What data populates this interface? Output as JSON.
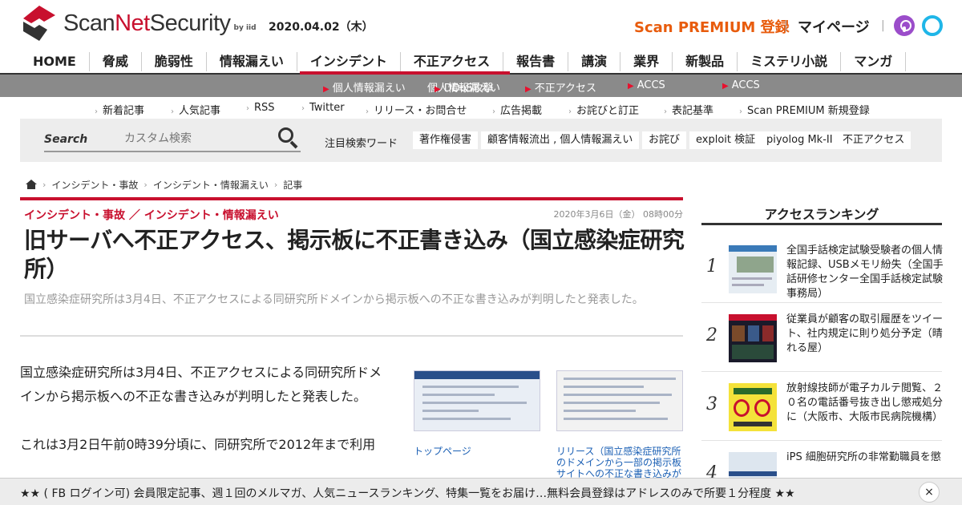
{
  "header": {
    "logo_text_scan": "Scan",
    "logo_text_net": "Net",
    "logo_text_security": "Security",
    "logo_byiid": "by iid",
    "date": "2020.04.02（木）",
    "premium_label": "Scan PREMIUM 登録",
    "mypage_label": "マイページ",
    "separator": "|"
  },
  "nav": {
    "items": [
      "HOME",
      "脅威",
      "脆弱性",
      "情報漏えい",
      "インシデント",
      "不正アクセス",
      "報告書",
      "講演",
      "業界",
      "新製品",
      "ミステリ小説",
      "マンガ"
    ],
    "active": "インシデント"
  },
  "subnav": {
    "items": [
      "個人情報漏えい",
      "個人情報漏えい",
      "DDoS攻撃",
      "不正アクセス",
      "ACCS",
      "ACCS"
    ]
  },
  "links": {
    "items": [
      "新着記事",
      "人気記事",
      "RSS",
      "Twitter",
      "リリース・お問合せ",
      "広告掲載",
      "お詫びと訂正",
      "表記基準",
      "Scan PREMIUM 新規登録"
    ]
  },
  "search": {
    "label": "Search",
    "placeholder": "カスタム検索",
    "keywords_label": "注目検索ワード",
    "keywords": [
      "著作権侵害",
      "顧客情報流出 , 個人情報漏えい",
      "お詫び",
      "exploit 検証",
      "piyolog Mk-II",
      "不正アクセス"
    ]
  },
  "breadcrumb": {
    "items": [
      "インシデント・事故",
      "インシデント・情報漏えい",
      "記事"
    ]
  },
  "article": {
    "category": "インシデント・事故 ／ インシデント・情報漏えい",
    "date": "2020年3月6日（金） 08時00分",
    "title": "旧サーバへ不正アクセス、掲示板に不正書き込み（国立感染症研究所）",
    "lead": "国立感染症研究所は3月4日、不正アクセスによる同研究所ドメインから掲示板への不正な書き込みが判明したと発表した。",
    "body": [
      "国立感染症研究所は3月4日、不正アクセスによる同研究所ドメインから掲示板への不正な書き込みが判明したと発表した。",
      "これは3月2日午前0時39分頃に、同研究所で2012年まで利用"
    ],
    "images": [
      {
        "caption": "トップページ"
      },
      {
        "caption": "リリース（国立感染症研究所のドメインから一部の掲示板サイトへの不正な書き込みが"
      }
    ]
  },
  "ranking": {
    "heading": "アクセスランキング",
    "items": [
      {
        "rank": "1",
        "text": "全国手話検定試験受験者の個人情報記録、USBメモリ紛失（全国手話研修センター全国手話検定試験事務局）"
      },
      {
        "rank": "2",
        "text": "従業員が顧客の取引履歴をツイート、社内規定に則り処分予定（晴れる屋）"
      },
      {
        "rank": "3",
        "text": "放射線技師が電子カルテ閲覧、２０名の電話番号抜き出し懲戒処分に（大阪市、大阪市民病院機構）"
      },
      {
        "rank": "4",
        "text": "iPS 細胞研究所の非常勤職員を懲"
      }
    ]
  },
  "banner": {
    "text": "★★ ( FB ログイン可) 会員限定記事、週１回のメルマガ、人気ニュースランキング、特集一覧をお届け…無料会員登録はアドレスのみで所要１分程度 ★★",
    "close_label": "×"
  },
  "colors": {
    "brand_red": "#c8102e",
    "premium_orange": "#e85c0d",
    "link_blue": "#1a5fb4",
    "podcast_purple": "#9b4dca",
    "ring_cyan": "#1fb6e8"
  }
}
